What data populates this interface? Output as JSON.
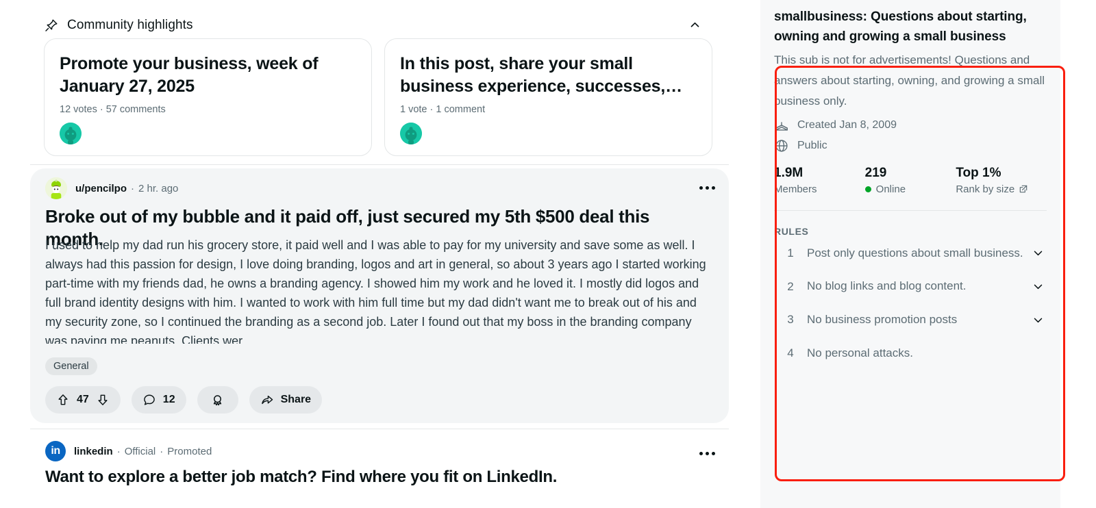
{
  "highlights": {
    "section_label": "Community highlights",
    "pin_icon": "pin-icon",
    "collapse_icon": "chevron-up-icon",
    "cards": [
      {
        "title": "Promote your business, week of January 27, 2025",
        "meta": "12 votes · 57 comments",
        "avatar": "subreddit-avatar"
      },
      {
        "title": "In this post, share your small business experience, successes,…",
        "meta": "1 vote · 1 comment",
        "avatar": "subreddit-avatar"
      }
    ]
  },
  "post": {
    "author": "u/pencilpo",
    "separator": "·",
    "timestamp": "2 hr. ago",
    "menu_icon": "overflow-menu-icon",
    "title": "Broke out of my bubble and it paid off, just secured my 5th $500 deal this month.",
    "body": "I used to help my dad run his grocery store, it paid well and I was able to pay for my university and save some as well. I always had this passion for design, I love doing branding, logos and art in general, so about 3 years ago I started working part-time with my friends dad, he owns a branding agency. I showed him my work and he loved it. I mostly did logos and full brand identity designs with him. I wanted to work with him full time but my dad didn't want me to break out of his and my security zone, so I continued the branding as a second job. Later I found out that my boss in the branding company was paying me peanuts. Clients wer…",
    "flair": "General",
    "actions": {
      "upvote_icon": "upvote-arrow-icon",
      "score": "47",
      "downvote_icon": "downvote-arrow-icon",
      "comment_icon": "comment-bubble-icon",
      "comment_count": "12",
      "award_icon": "award-badge-icon",
      "share_icon": "share-arrow-icon",
      "share_label": "Share"
    }
  },
  "promoted": {
    "logo_text": "in",
    "logo_icon": "linkedin-logo-icon",
    "name": "linkedin",
    "official": "Official",
    "separator": "·",
    "promoted_label": "Promoted",
    "menu_icon": "overflow-menu-icon",
    "title": "Want to explore a better job match? Find where you fit on LinkedIn."
  },
  "sidebar": {
    "title": "smallbusiness: Questions about starting, owning and growing a small business",
    "description": "This sub is not for advertisements! Questions and answers about starting, owning, and growing a small business only.",
    "created": {
      "icon": "cake-icon",
      "text": "Created Jan 8, 2009"
    },
    "visibility": {
      "icon": "globe-icon",
      "text": "Public"
    },
    "stats": [
      {
        "value": "1.9M",
        "label": "Members",
        "has_dot": false,
        "has_ext": false
      },
      {
        "value": "219",
        "label": "Online",
        "has_dot": true,
        "has_ext": false
      },
      {
        "value": "Top 1%",
        "label": "Rank by size",
        "has_dot": false,
        "has_ext": true
      }
    ],
    "rules_header": "RULES",
    "rules": [
      {
        "num": "1",
        "text": "Post only questions about small business.",
        "chevron": "chevron-down-icon"
      },
      {
        "num": "2",
        "text": "No blog links and blog content.",
        "chevron": "chevron-down-icon"
      },
      {
        "num": "3",
        "text": "No business promotion posts",
        "chevron": "chevron-down-icon"
      },
      {
        "num": "4",
        "text": "No personal attacks.",
        "chevron": ""
      }
    ]
  },
  "annotation": {
    "name": "red-highlight-rectangle",
    "color": "#fa1e0e"
  }
}
